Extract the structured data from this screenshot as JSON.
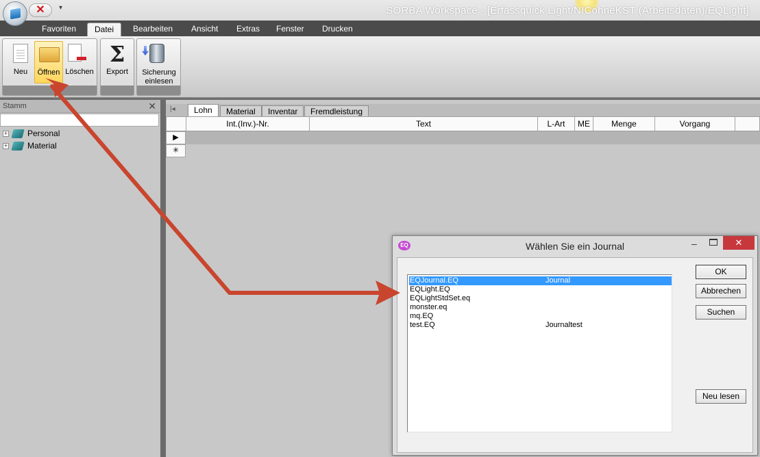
{
  "window": {
    "title": "SORBA Workspace - [Erfassquick Light/NICohneKST (Arbeitsdaten)/EQLight]"
  },
  "menubar": {
    "items": [
      "Favoriten",
      "Datei",
      "Bearbeiten",
      "Ansicht",
      "Extras",
      "Fenster",
      "Drucken"
    ],
    "active": "Datei"
  },
  "ribbon": {
    "neu": "Neu",
    "oeffnen": "Öffnen",
    "loeschen": "Löschen",
    "export": "Export",
    "sicherung_line1": "Sicherung",
    "sicherung_line2": "einlesen"
  },
  "leftpanel": {
    "title": "Stamm",
    "tree": [
      "Personal",
      "Material"
    ]
  },
  "grid": {
    "tabs": [
      "Lohn",
      "Material",
      "Inventar",
      "Fremdleistung"
    ],
    "active_tab": "Lohn",
    "columns": [
      "Int.(Inv.)-Nr.",
      "Text",
      "L-Art",
      "ME",
      "Menge",
      "Vorgang"
    ]
  },
  "dialog": {
    "title": "Wählen Sie ein Journal",
    "icon_text": "EQ",
    "journals": [
      {
        "name": "EQJournal.EQ",
        "desc": "Journal",
        "selected": true
      },
      {
        "name": "EQLight.EQ",
        "desc": ""
      },
      {
        "name": "EQLightStdSet.eq",
        "desc": ""
      },
      {
        "name": "monster.eq",
        "desc": ""
      },
      {
        "name": "mq.EQ",
        "desc": ""
      },
      {
        "name": "test.EQ",
        "desc": "Journaltest"
      }
    ],
    "buttons": {
      "ok": "OK",
      "cancel": "Abbrechen",
      "search": "Suchen",
      "reload": "Neu lesen"
    }
  },
  "colors": {
    "annotation_arrow": "#c9452e",
    "selection": "#3399ff",
    "close_button": "#c7383d"
  }
}
